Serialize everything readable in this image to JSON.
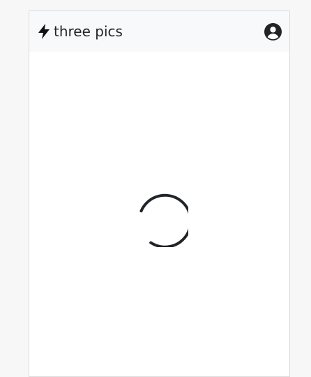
{
  "app": {
    "brand_name": "three pics",
    "brand_icon": "bolt-icon"
  },
  "header": {
    "profile_icon": "user-circle-icon"
  },
  "main": {
    "loading_indicator": "loading-spinner"
  },
  "colors": {
    "navbar_bg": "#f8f9fa",
    "text": "#212529",
    "page_bg": "#f7f7f7"
  }
}
